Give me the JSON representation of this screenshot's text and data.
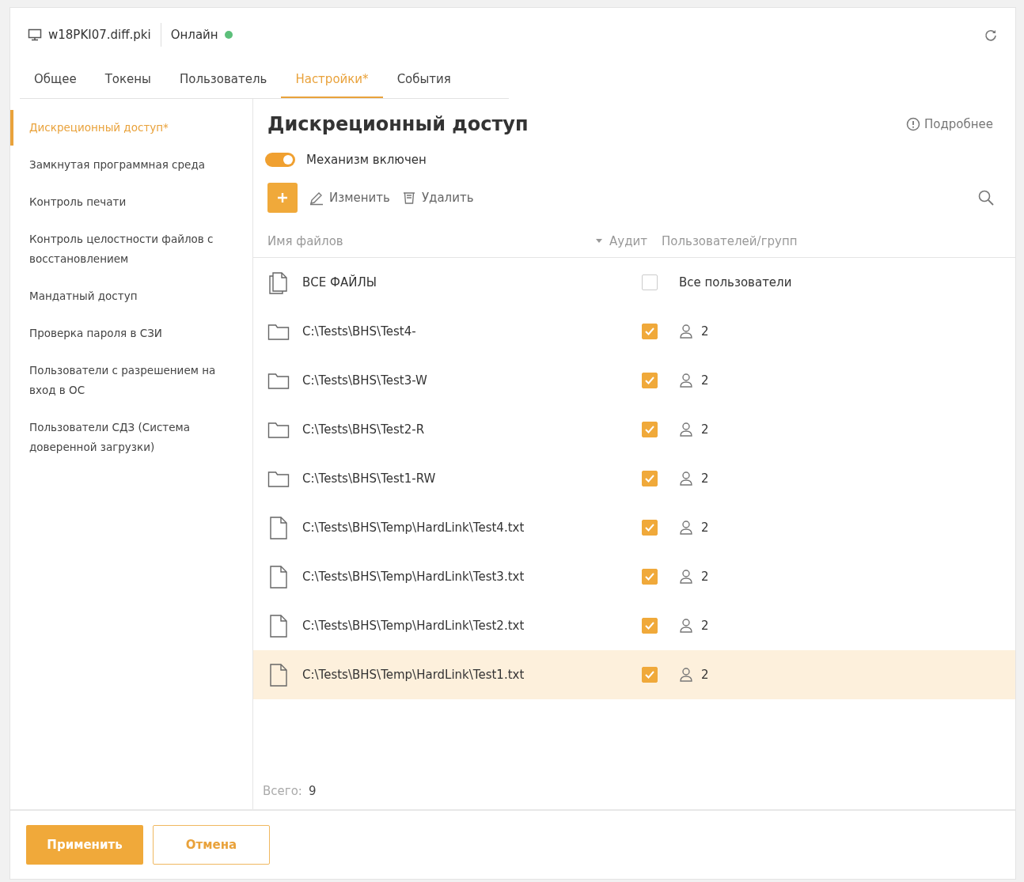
{
  "header": {
    "host": "w18PKI07.diff.pki",
    "status": "Онлайн",
    "online": true
  },
  "tabs": [
    {
      "label": "Общее",
      "selected": false
    },
    {
      "label": "Токены",
      "selected": false
    },
    {
      "label": "Пользователь",
      "selected": false
    },
    {
      "label": "Настройки*",
      "selected": true
    },
    {
      "label": "События",
      "selected": false
    }
  ],
  "sidebar": {
    "items": [
      {
        "label": "Дискреционный доступ*",
        "selected": true
      },
      {
        "label": "Замкнутая программная среда",
        "selected": false
      },
      {
        "label": "Контроль печати",
        "selected": false
      },
      {
        "label": "Контроль целостности файлов с восстановлением",
        "selected": false
      },
      {
        "label": "Мандатный доступ",
        "selected": false
      },
      {
        "label": "Проверка пароля в СЗИ",
        "selected": false
      },
      {
        "label": "Пользователи с разрешением на вход в ОС",
        "selected": false
      },
      {
        "label": "Пользователи СДЗ (Система доверенной загрузки)",
        "selected": false
      }
    ]
  },
  "panel": {
    "title": "Дискреционный доступ",
    "help_link": "Подробнее",
    "toggle": {
      "label": "Механизм включен",
      "on": true
    },
    "toolbar": {
      "edit": "Изменить",
      "delete": "Удалить"
    }
  },
  "table": {
    "columns": [
      "Имя файлов",
      "Аудит",
      "Пользователей/групп"
    ],
    "rows": [
      {
        "kind": "all",
        "name": "ВСЕ ФАЙЛЫ",
        "audit": false,
        "users": "Все пользователи",
        "selected": false
      },
      {
        "kind": "folder",
        "name": "C:\\Tests\\BHS\\Test4-",
        "audit": true,
        "users": "2",
        "selected": false
      },
      {
        "kind": "folder",
        "name": "C:\\Tests\\BHS\\Test3-W",
        "audit": true,
        "users": "2",
        "selected": false
      },
      {
        "kind": "folder",
        "name": "C:\\Tests\\BHS\\Test2-R",
        "audit": true,
        "users": "2",
        "selected": false
      },
      {
        "kind": "folder",
        "name": "C:\\Tests\\BHS\\Test1-RW",
        "audit": true,
        "users": "2",
        "selected": false
      },
      {
        "kind": "file",
        "name": "C:\\Tests\\BHS\\Temp\\HardLink\\Test4.txt",
        "audit": true,
        "users": "2",
        "selected": false
      },
      {
        "kind": "file",
        "name": "C:\\Tests\\BHS\\Temp\\HardLink\\Test3.txt",
        "audit": true,
        "users": "2",
        "selected": false
      },
      {
        "kind": "file",
        "name": "C:\\Tests\\BHS\\Temp\\HardLink\\Test2.txt",
        "audit": true,
        "users": "2",
        "selected": false
      },
      {
        "kind": "file",
        "name": "C:\\Tests\\BHS\\Temp\\HardLink\\Test1.txt",
        "audit": true,
        "users": "2",
        "selected": true
      }
    ]
  },
  "total": {
    "label": "Всего:",
    "value": "9"
  },
  "buttons": {
    "apply": "Применить",
    "cancel": "Отмена"
  }
}
